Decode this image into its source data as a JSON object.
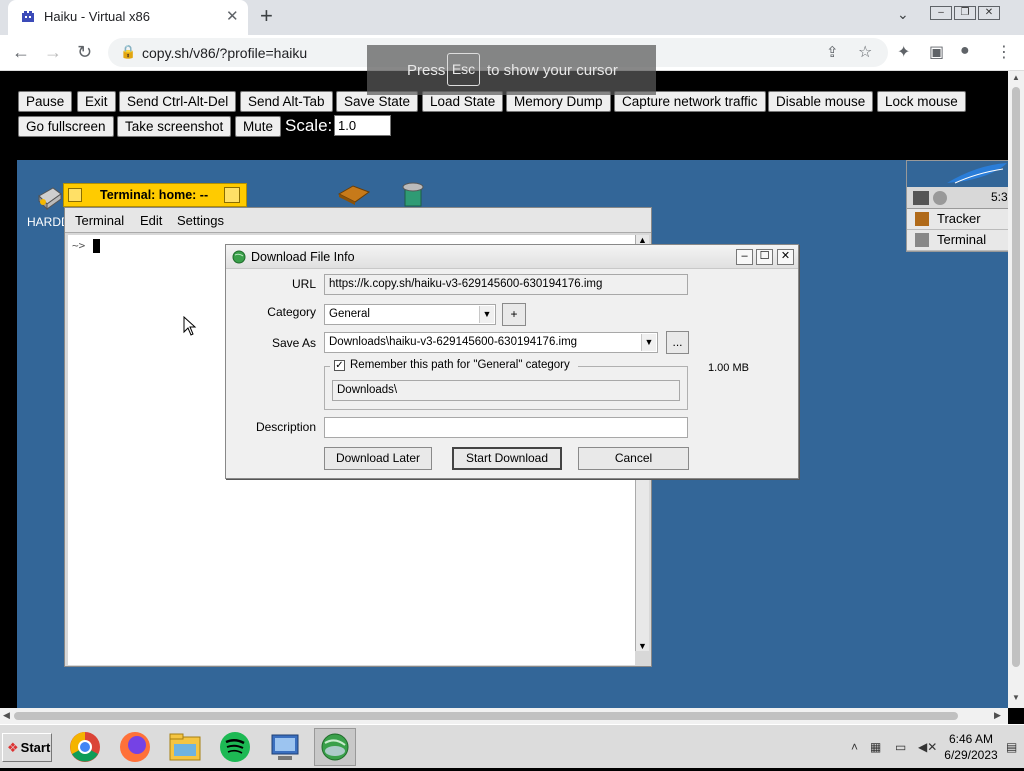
{
  "browser": {
    "tab_title": "Haiku - Virtual x86",
    "tab_close": "✕",
    "new_tab": "+",
    "url": "copy.sh/v86/?profile=haiku"
  },
  "esc_toast": {
    "before": "Press",
    "key": "Esc",
    "after": "to show your cursor"
  },
  "controls": {
    "buttons": [
      "Pause",
      "Exit",
      "Send Ctrl-Alt-Del",
      "Send Alt-Tab",
      "Save State",
      "Load State",
      "Memory Dump",
      "Capture network traffic",
      "Disable mouse",
      "Lock mouse",
      "Go fullscreen",
      "Take screenshot",
      "Mute"
    ],
    "scale_label": "Scale:",
    "scale_value": "1.0"
  },
  "desktop": {
    "icon_label": "HARDD",
    "deskbar": {
      "clock": "5:3",
      "items": [
        "Tracker",
        "Terminal"
      ]
    }
  },
  "terminal": {
    "title": "Terminal: home: --",
    "menu": [
      "Terminal",
      "Edit",
      "Settings"
    ],
    "prompt": "~>"
  },
  "dialog": {
    "title": "Download File Info",
    "url_label": "URL",
    "url_value": "https://k.copy.sh/haiku-v3-629145600-630194176.img",
    "category_label": "Category",
    "category_value": "General",
    "add_btn": "+",
    "saveas_label": "Save As",
    "saveas_value": "Downloads\\haiku-v3-629145600-630194176.img",
    "browse_btn": "...",
    "remember_label": "Remember this path for \"General\" category",
    "remember_checked": true,
    "path_value": "Downloads\\",
    "size": "1.00  MB",
    "description_label": "Description",
    "description_value": "",
    "btn_later": "Download Later",
    "btn_start": "Start Download",
    "btn_cancel": "Cancel"
  },
  "taskbar": {
    "start": "Start",
    "time": "6:46 AM",
    "date": "6/29/2023",
    "apps": [
      "chrome-icon",
      "firefox-icon",
      "file-explorer-icon",
      "spotify-icon",
      "remote-desktop-icon",
      "download-manager-icon"
    ]
  }
}
